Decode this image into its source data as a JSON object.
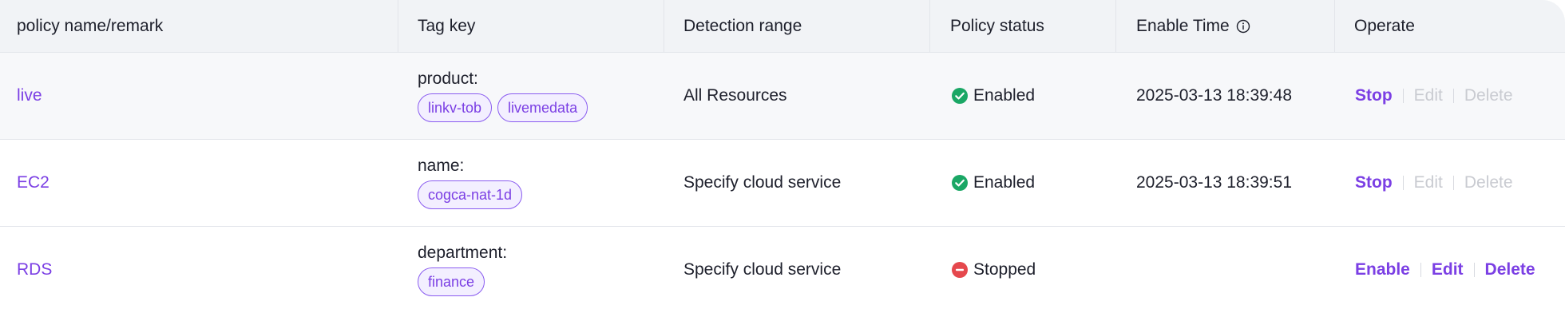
{
  "header": {
    "col_name": "policy name/remark",
    "col_tag": "Tag key",
    "col_range": "Detection range",
    "col_status": "Policy status",
    "col_enable_time": "Enable Time",
    "col_operate": "Operate"
  },
  "rows": [
    {
      "name": "live",
      "tag_key": "product:",
      "tags": [
        "linkv-tob",
        "livemedata"
      ],
      "range": "All Resources",
      "status": "Enabled",
      "enable_time": "2025-03-13 18:39:48",
      "ops": [
        "Stop",
        "Edit",
        "Delete"
      ]
    },
    {
      "name": "EC2",
      "tag_key": "name:",
      "tags": [
        "cogca-nat-1d"
      ],
      "range": "Specify cloud service",
      "status": "Enabled",
      "enable_time": "2025-03-13 18:39:51",
      "ops": [
        "Stop",
        "Edit",
        "Delete"
      ]
    },
    {
      "name": "RDS",
      "tag_key": "department:",
      "tags": [
        "finance"
      ],
      "range": "Specify cloud service",
      "status": "Stopped",
      "enable_time": "",
      "ops": [
        "Enable",
        "Edit",
        "Delete"
      ]
    }
  ],
  "colors": {
    "accent": "#7b3fe4",
    "enabled": "#1aa765",
    "stopped": "#e5484d",
    "disabled_text": "#c9cbd1"
  }
}
